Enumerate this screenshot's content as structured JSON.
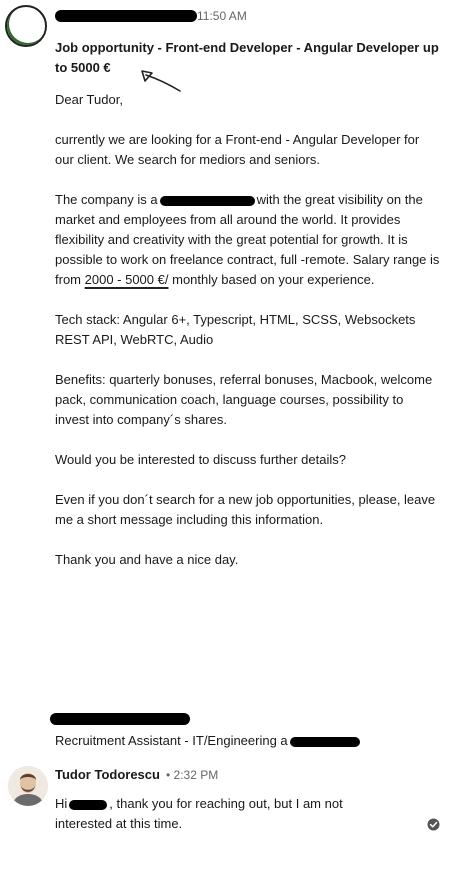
{
  "message1": {
    "time": "11:50 AM",
    "subject": "Job opportunity - Front-end Developer - Angular Developer up to 5000 €",
    "greeting": "Dear Tudor,",
    "p1": "currently we are looking for a Front-end - Angular Developer for our client. We search for mediors and seniors.",
    "p2_a": "The company is a",
    "p2_b": "with the great visibility on the market and employees from all around the world. It provides flexibility and creativity with the great potential for growth. It is possible to work on freelance contract, full -remote. Salary range is from",
    "p2_salary": "2000 - 5000 €/",
    "p2_c": "monthly based on your experience.",
    "tech_line1": "Tech stack: Angular 6+, Typescript, HTML, SCSS, Websockets",
    "tech_line2": "REST API, WebRTC, Audio",
    "benefits": "Benefits: quarterly bonuses, referral bonuses, Macbook, welcome pack, communication coach, language courses, possibility to invest into company´s shares.",
    "question": "Would you be interested to discuss further details?",
    "even_if": "Even if you don´t search for a new job opportunities, please, leave me a short message including this information.",
    "thanks": "Thank you and have a nice day.",
    "signature_title": "Recruitment Assistant - IT/Engineering a"
  },
  "message2": {
    "sender": "Tudor Todorescu",
    "time": "• 2:32 PM",
    "reply_a": "Hi",
    "reply_b": ", thank you for reaching out, but I am not interested at this time."
  },
  "icons": {
    "read_receipt": "check-circle-icon",
    "annotation": "hand-drawn-arrow-icon"
  },
  "colors": {
    "text": "#1a1a1a",
    "muted": "#666666",
    "avatar_ring": "#2f6b2f"
  }
}
